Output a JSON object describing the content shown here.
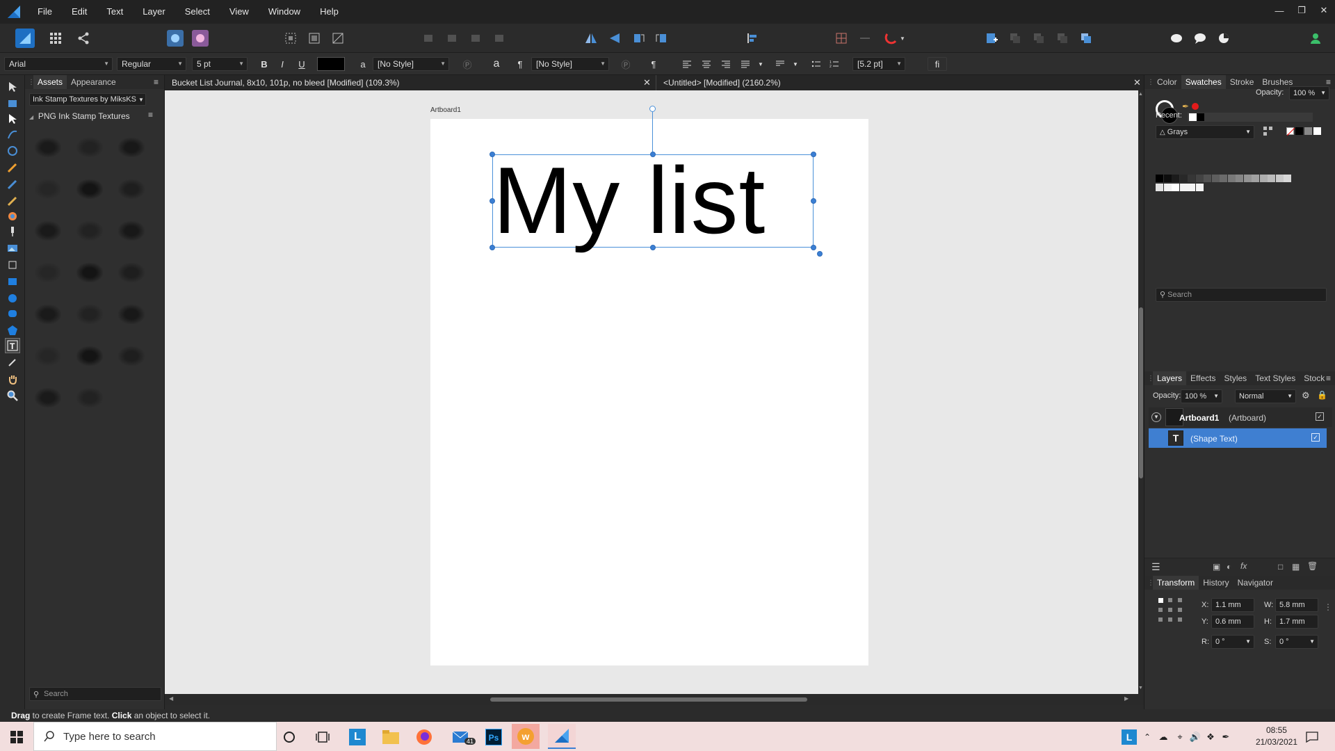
{
  "menu": [
    "File",
    "Edit",
    "Text",
    "Layer",
    "Select",
    "View",
    "Window",
    "Help"
  ],
  "context": {
    "font_family": "Arial",
    "font_style": "Regular",
    "font_size": "5 pt",
    "bold": "B",
    "italic": "I",
    "underline": "U",
    "char_style": "[No Style]",
    "para_style": "[No Style]",
    "leading": "[5.2 pt]",
    "a_glyph": "a",
    "pilcrow": "¶",
    "ligature": "fi"
  },
  "assets": {
    "tabs": [
      "Assets",
      "Appearance"
    ],
    "category": "Ink Stamp Textures by MiksKS",
    "group": "PNG Ink Stamp Textures",
    "search_placeholder": "Search"
  },
  "documents": {
    "tab1": "Bucket List Journal, 8x10, 101p, no bleed [Modified] (109.3%)",
    "tab2": "<Untitled> [Modified] (2160.2%)"
  },
  "canvas": {
    "artboard_label": "Artboard1",
    "text": "My list"
  },
  "color_panel": {
    "tabs": [
      "Color",
      "Swatches",
      "Stroke",
      "Brushes"
    ],
    "opacity_label": "Opacity:",
    "opacity_value": "100 %",
    "recent_label": "Recent:",
    "palette": "Grays",
    "search_placeholder": "Search"
  },
  "layers_panel": {
    "tabs": [
      "Layers",
      "Effects",
      "Styles",
      "Text Styles",
      "Stock"
    ],
    "opacity_label": "Opacity:",
    "opacity_value": "100 %",
    "blend": "Normal",
    "layer1_name": "Artboard1",
    "layer1_type": "(Artboard)",
    "layer2_name": "(Shape Text)"
  },
  "transform_panel": {
    "tabs": [
      "Transform",
      "History",
      "Navigator"
    ],
    "x_label": "X:",
    "x": "1.1 mm",
    "y_label": "Y:",
    "y": "0.6 mm",
    "w_label": "W:",
    "w": "5.8 mm",
    "h_label": "H:",
    "h": "1.7 mm",
    "r_label": "R:",
    "r": "0 °",
    "s_label": "S:",
    "s": "0 °"
  },
  "status": {
    "drag": "Drag",
    "drag_text": " to create Frame text. ",
    "click": "Click",
    "click_text": " an object to select it."
  },
  "taskbar": {
    "search_placeholder": "Type here to search",
    "mail_badge": "41",
    "time": "08:55",
    "date": "21/03/2021"
  },
  "colors": {
    "accent": "#3b7fd4",
    "selection": "#4a90d9",
    "layer_selected": "#3f7fd1"
  }
}
